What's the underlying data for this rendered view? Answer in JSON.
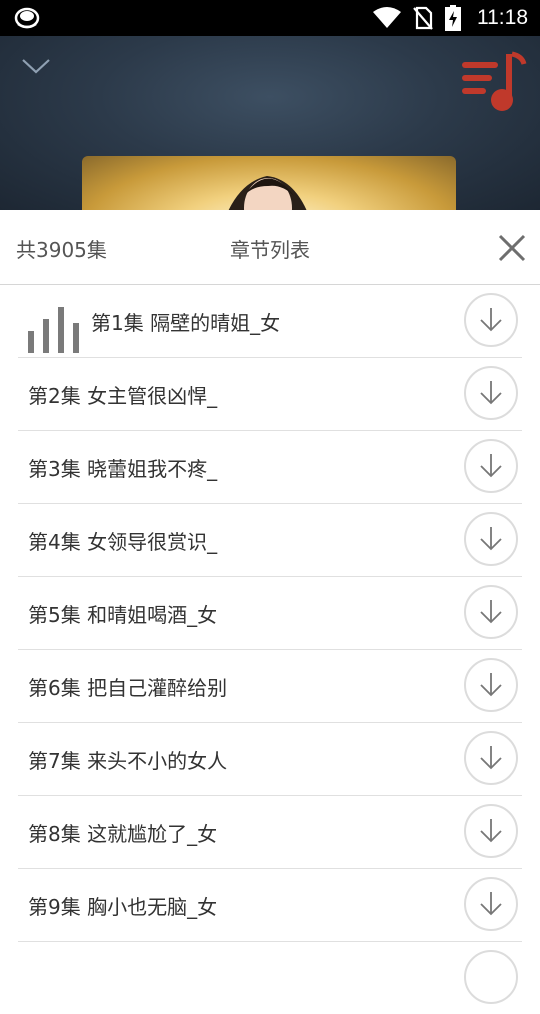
{
  "status_bar": {
    "time": "11:18",
    "icons": [
      "app-notification-icon",
      "wifi-icon",
      "no-sim-icon",
      "battery-charging-icon"
    ]
  },
  "player": {
    "collapse_icon": "chevron-down-icon",
    "playlist_icon": "playlist-music-icon",
    "accent_color": "#c0392b"
  },
  "chapter_panel": {
    "episode_count": "共3905集",
    "title": "章节列表",
    "close_icon": "close-icon",
    "download_icon": "download-icon",
    "playing_icon": "playing-bars-icon",
    "chapters": [
      {
        "label": "第1集 隔壁的晴姐_女",
        "playing": true
      },
      {
        "label": "第2集 女主管很凶悍_",
        "playing": false
      },
      {
        "label": "第3集 晓蕾姐我不疼_",
        "playing": false
      },
      {
        "label": "第4集 女领导很赏识_",
        "playing": false
      },
      {
        "label": "第5集 和晴姐喝酒_女",
        "playing": false
      },
      {
        "label": "第6集 把自己灌醉给别",
        "playing": false
      },
      {
        "label": "第7集 来头不小的女人",
        "playing": false
      },
      {
        "label": "第8集 这就尴尬了_女",
        "playing": false
      },
      {
        "label": "第9集 胸小也无脑_女",
        "playing": false
      }
    ]
  }
}
